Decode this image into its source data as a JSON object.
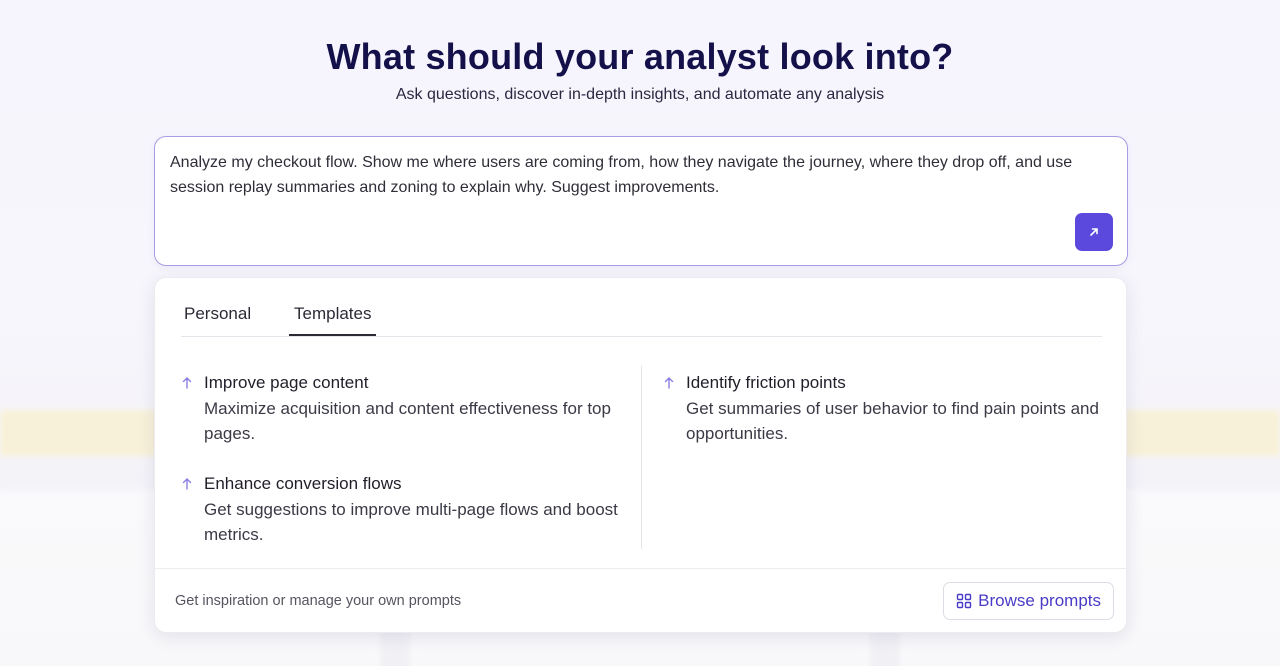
{
  "header": {
    "title": "What should your analyst look into?",
    "subtitle": "Ask questions, discover in-depth insights, and automate any analysis"
  },
  "prompt": {
    "value": "Analyze my checkout flow. Show me where users are coming from, how they navigate the journey, where they drop off, and use session replay summaries and zoning to explain why. Suggest improvements.",
    "send_icon": "arrow-up-right-icon"
  },
  "tabs": [
    {
      "label": "Personal",
      "active": false
    },
    {
      "label": "Templates",
      "active": true
    }
  ],
  "templates": [
    {
      "title": "Improve page content",
      "description": "Maximize acquisition and content effectiveness for top pages.",
      "icon": "arrow-up-icon"
    },
    {
      "title": "Enhance conversion flows",
      "description": "Get suggestions to improve multi-page flows and boost metrics.",
      "icon": "arrow-up-icon"
    },
    {
      "title": "Identify friction points",
      "description": "Get summaries of user behavior to find pain points and opportunities.",
      "icon": "arrow-up-icon"
    }
  ],
  "footer": {
    "text": "Get inspiration or manage your own prompts",
    "browse_label": "Browse prompts",
    "browse_icon": "grid-icon"
  },
  "colors": {
    "accent": "#5b49dd",
    "title": "#14104a",
    "banner": "#fbefbf"
  }
}
